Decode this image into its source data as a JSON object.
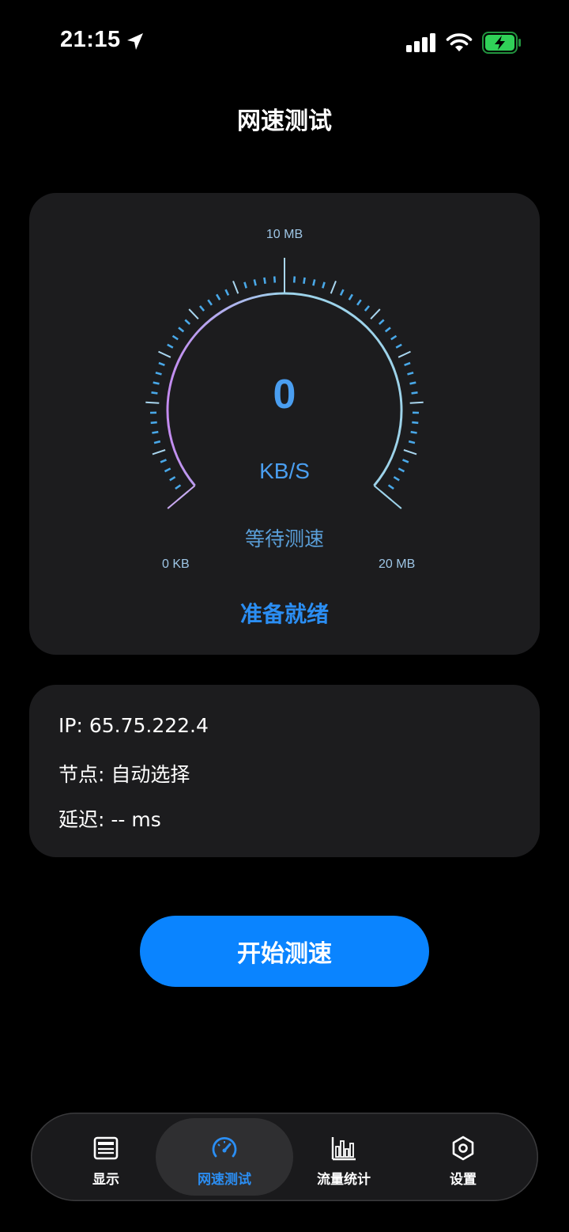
{
  "status_bar": {
    "time": "21:15",
    "icons": [
      "location-arrow-icon",
      "cellular-signal-icon",
      "wifi-icon",
      "battery-charging-icon"
    ],
    "battery_color": "#30d158"
  },
  "header": {
    "title": "网速测试"
  },
  "gauge": {
    "max_label": "10 MB",
    "min_label": "0 KB",
    "end_label": "20 MB",
    "value": "0",
    "unit": "KB/S",
    "status": "等待测速",
    "ready": "准备就绪",
    "colors": {
      "progress_start": "#c48bf0",
      "progress_end": "#9dd3ea",
      "ticks": "#49a8e8",
      "accent": "#2b8ef3"
    }
  },
  "info": {
    "ip": "IP: 65.75.222.4",
    "node": "节点: 自动选择",
    "latency": "延迟: -- ms"
  },
  "actions": {
    "start_label": "开始测速",
    "start_color": "#0a84ff"
  },
  "tabs": [
    {
      "label": "显示",
      "icon": "display-list-icon",
      "active": false
    },
    {
      "label": "网速测试",
      "icon": "speedometer-icon",
      "active": true
    },
    {
      "label": "流量统计",
      "icon": "bar-chart-icon",
      "active": false
    },
    {
      "label": "设置",
      "icon": "hexagon-settings-icon",
      "active": false
    }
  ]
}
